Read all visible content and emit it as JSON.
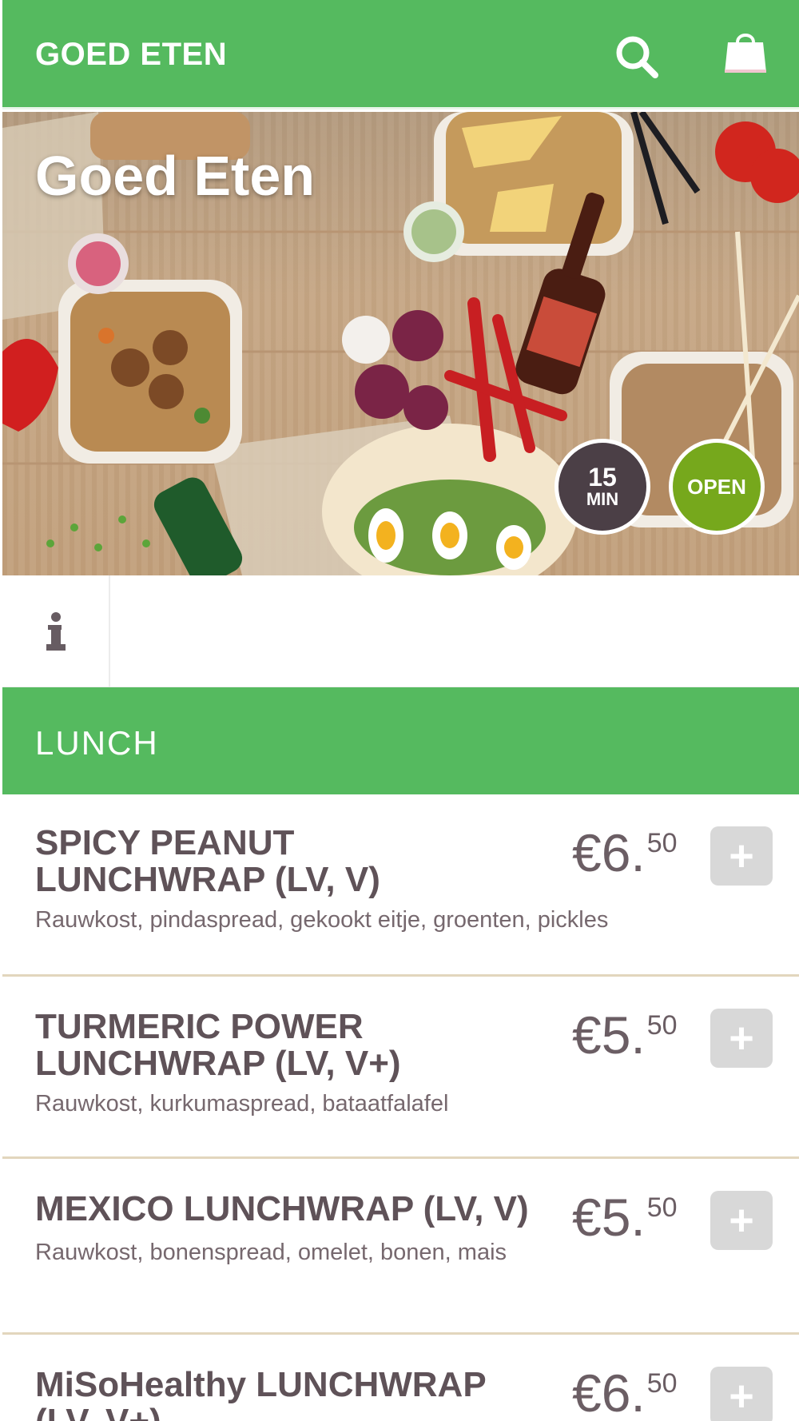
{
  "header": {
    "brand": "GOED ETEN",
    "search_icon": "search-icon",
    "cart_icon": "shopping-bag-icon"
  },
  "hero": {
    "title": "Goed Eten",
    "delivery_time": "15",
    "delivery_unit": "MIN",
    "status": "OPEN"
  },
  "info_tab": {
    "icon": "info-icon"
  },
  "category": {
    "title": "LUNCH"
  },
  "menu": [
    {
      "name": "SPICY PEANUT LUNCHWRAP (LV, V)",
      "desc": "Rauwkost, pindaspread, gekookt eitje, groenten, pickles",
      "price_main": "€6.",
      "price_cents": "50",
      "add_label": "+"
    },
    {
      "name": "TURMERIC POWER LUNCHWRAP (LV, V+)",
      "desc": "Rauwkost, kurkumaspread, bataatfalafel",
      "price_main": "€5.",
      "price_cents": "50",
      "add_label": "+"
    },
    {
      "name": "MEXICO LUNCHWRAP (LV, V)",
      "desc": "Rauwkost, bonenspread, omelet, bonen, mais",
      "price_main": "€5.",
      "price_cents": "50",
      "add_label": "+"
    },
    {
      "name": "MiSoHealthy LUNCHWRAP (LV, V+)",
      "desc": "",
      "price_main": "€6.",
      "price_cents": "50",
      "add_label": "+"
    }
  ],
  "colors": {
    "brand_green": "#55ba5f",
    "open_green": "#76a81c",
    "time_badge": "#4b3f46",
    "text_dark": "#5f5258",
    "divider": "#e2d6bd"
  }
}
